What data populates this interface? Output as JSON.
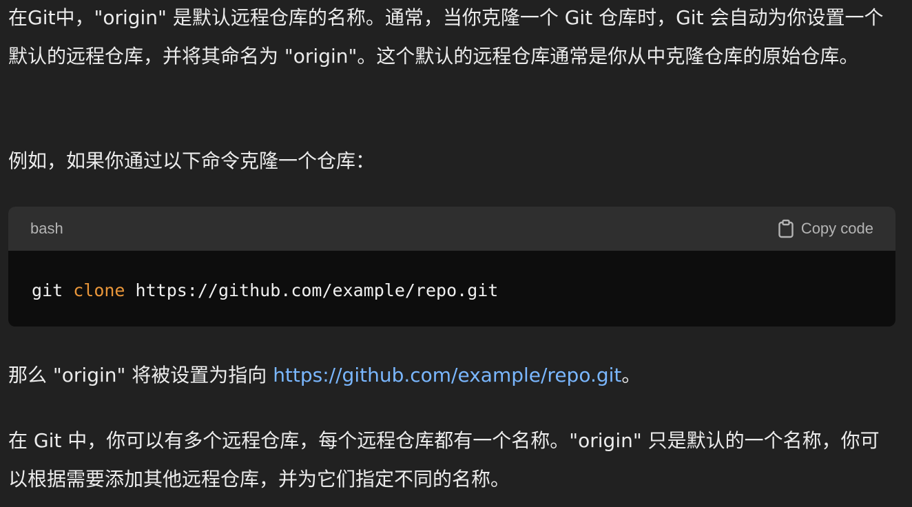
{
  "paragraphs": {
    "p1": "在Git中，\"origin\" 是默认远程仓库的名称。通常，当你克隆一个 Git 仓库时，Git 会自动为你设置一个默认的远程仓库，并将其命名为 \"origin\"。这个默认的远程仓库通常是你从中克隆仓库的原始仓库。",
    "p2": "例如，如果你通过以下命令克隆一个仓库：",
    "p3_prefix": "那么 \"origin\" 将被设置为指向 ",
    "p3_link": "https://github.com/example/repo.git",
    "p3_suffix": "。",
    "p4": "在 Git 中，你可以有多个远程仓库，每个远程仓库都有一个名称。\"origin\" 只是默认的一个名称，你可以根据需要添加其他远程仓库，并为它们指定不同的名称。"
  },
  "code_block": {
    "language": "bash",
    "copy_label": "Copy code",
    "copy_icon": "clipboard-icon",
    "command": "git",
    "subcommand": "clone",
    "argument": "https://github.com/example/repo.git"
  },
  "colors": {
    "background": "#212121",
    "text": "#ececec",
    "link": "#7ab7ff",
    "code_header_bg": "#2f2f2f",
    "code_body_bg": "#0d0d0d",
    "code_keyword": "#e9963a"
  }
}
